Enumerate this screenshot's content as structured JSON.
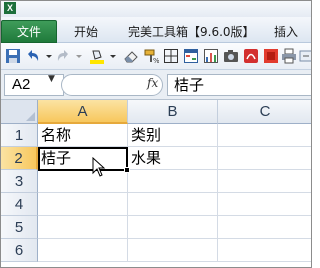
{
  "titlebar": {
    "logo": "X"
  },
  "tabs": {
    "file": "文件",
    "start": "开始",
    "toolbox": "完美工具箱【9.6.0版】",
    "insert": "插入"
  },
  "qat": {
    "icons": [
      "save-icon",
      "undo-icon",
      "redo-icon",
      "fill-color-icon",
      "eraser-icon",
      "format-painter-icon",
      "borders-icon",
      "table-icon",
      "chart-icon",
      "photo-icon",
      "pdf-icon",
      "print-icon",
      "more-icon"
    ]
  },
  "formula_bar": {
    "name_box": "A2",
    "fx_label": "fx",
    "formula": "桔子"
  },
  "grid": {
    "columns": [
      "A",
      "B",
      "C"
    ],
    "rows": [
      "1",
      "2",
      "3",
      "4",
      "5",
      "6"
    ],
    "cells": {
      "A1": "名称",
      "B1": "类别",
      "A2": "桔子",
      "B2": "水果"
    },
    "selected_column": "A",
    "selected_row": "2"
  },
  "colors": {
    "file_tab": "#2a8a48",
    "header_selected": "#f7c75d",
    "grid_line": "#d4dbe5"
  }
}
